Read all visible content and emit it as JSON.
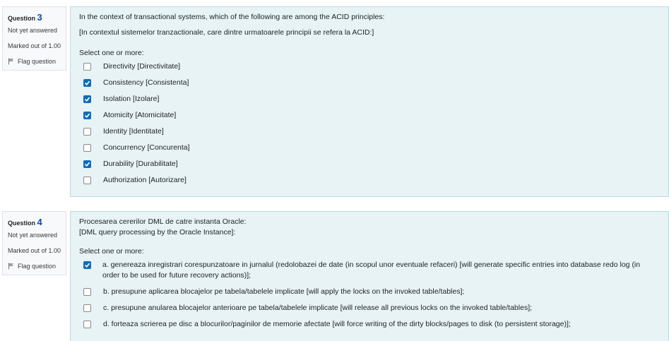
{
  "q3": {
    "label": "Question",
    "number": "3",
    "state": "Not yet answered",
    "grade": "Marked out of 1.00",
    "flag": "Flag question",
    "text_en": "In the context of transactional systems, which of the following are among the ACID principles:",
    "text_ro": "[In contextul sistemelor tranzactionale, care dintre urmatoarele principii se refera la ACID:]",
    "prompt": "Select one or more:",
    "answers": [
      {
        "text": "Directivity [Directivitate]",
        "checked": false
      },
      {
        "text": "Consistency [Consistenta]",
        "checked": true
      },
      {
        "text": "Isolation [Izolare]",
        "checked": true
      },
      {
        "text": "Atomicity [Atomicitate]",
        "checked": true
      },
      {
        "text": "Identity [Identitate]",
        "checked": false
      },
      {
        "text": "Concurrency [Concurenta]",
        "checked": false
      },
      {
        "text": "Durability [Durabilitate]",
        "checked": true
      },
      {
        "text": "Authorization [Autorizare]",
        "checked": false
      }
    ]
  },
  "q4": {
    "label": "Question",
    "number": "4",
    "state": "Not yet answered",
    "grade": "Marked out of 1.00",
    "flag": "Flag question",
    "text_ro": "Procesarea cererilor DML de catre instanta Oracle:",
    "text_en": "[DML query processing by the Oracle Instance]:",
    "prompt": "Select one or more:",
    "answers": [
      {
        "text": "a. genereaza inregistrari corespunzatoare in jurnalul (redolobazei de date (in scopul unor eventuale refaceri) [will generate specific entries into database redo log (in order to be used for future recovery actions)];",
        "checked": true
      },
      {
        "text": "b. presupune aplicarea blocajelor pe tabela/tabelele implicate [will apply the locks on the invoked table/tables];",
        "checked": false
      },
      {
        "text": "c. presupune anularea blocajelor anterioare pe tabela/tabelele implicate [will release all previous locks on the invoked table/tables];",
        "checked": false
      },
      {
        "text": "d. forteaza scrierea pe disc a blocurilor/paginilor de memorie afectate [will force writing of the dirty blocks/pages to disk (to persistent storage)];",
        "checked": false
      }
    ]
  }
}
